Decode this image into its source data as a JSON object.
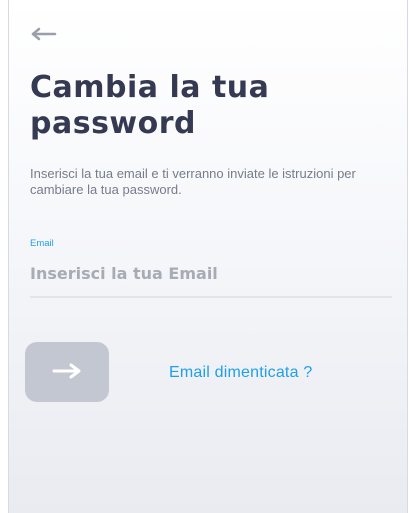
{
  "header": {
    "back_icon": "arrow-left-icon"
  },
  "page": {
    "title": "Cambia la tua password",
    "subtitle": "Inserisci la tua email e ti verranno inviate le istruzioni per cambiare la tua password."
  },
  "form": {
    "email_label": "Email",
    "email_value": "",
    "email_placeholder": "Inserisci la tua Email",
    "submit_icon": "arrow-right-icon",
    "forgot_email_link": "Email dimenticata ?"
  },
  "colors": {
    "title": "#353a52",
    "accent": "#1e9fe8",
    "button_disabled": "#c3c7d2"
  }
}
